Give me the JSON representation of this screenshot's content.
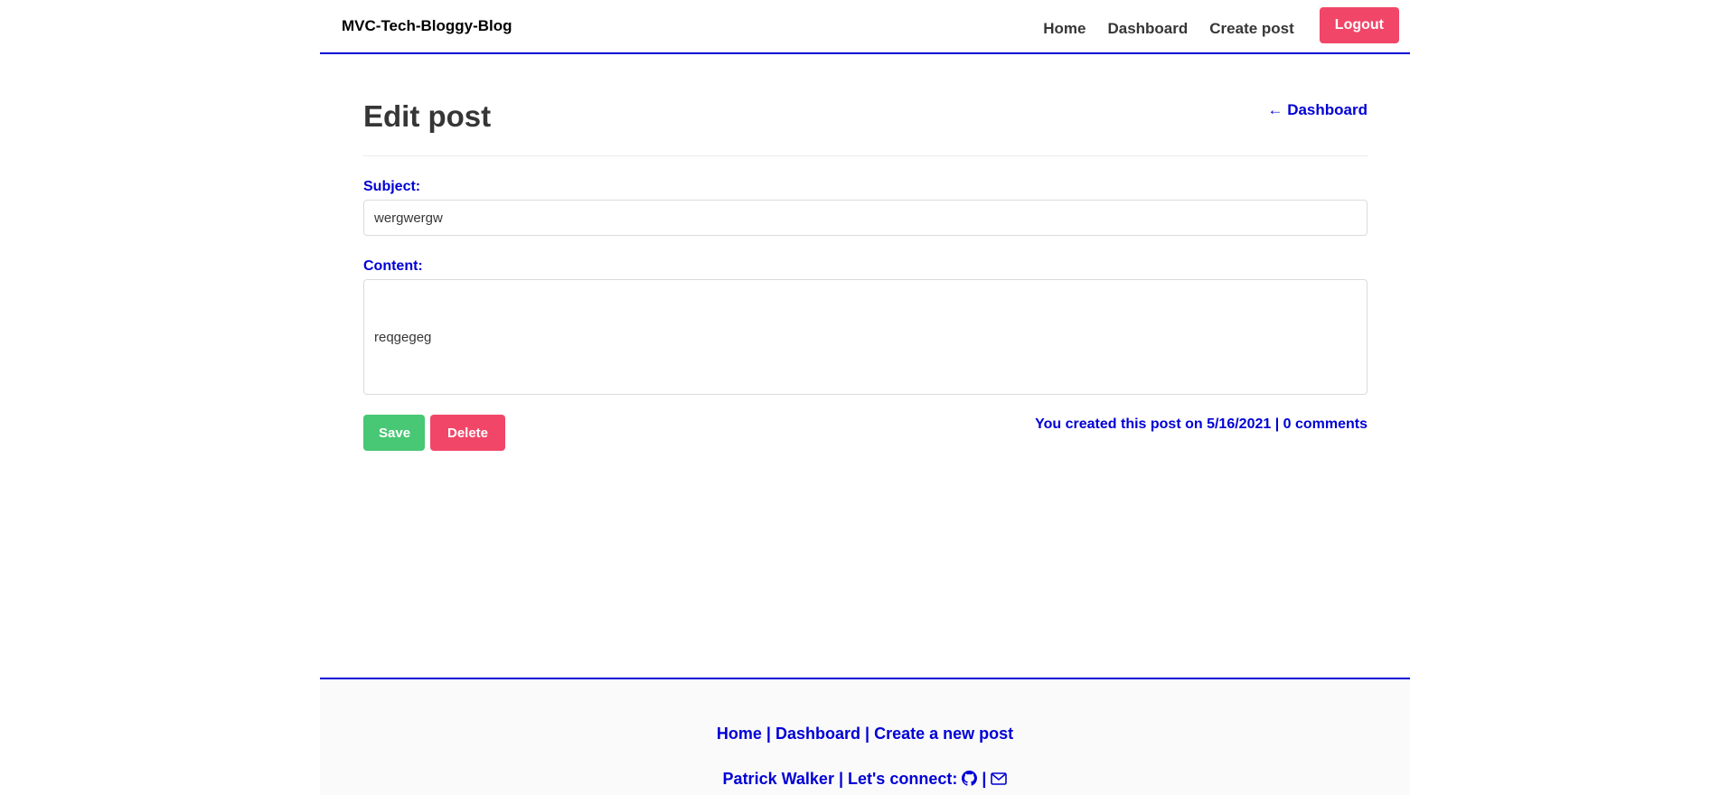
{
  "navbar": {
    "brand": "MVC-Tech-Bloggy-Blog",
    "links": [
      "Home",
      "Dashboard",
      "Create post"
    ],
    "logout_label": "Logout"
  },
  "main": {
    "title": "Edit post",
    "back_link": "← Dashboard",
    "subject_label": "Subject:",
    "subject_value": "wergwergw",
    "content_label": "Content:",
    "content_value": "reqgegeg",
    "save_label": "Save",
    "delete_label": "Delete",
    "post_meta": "You created this post on 5/16/2021 | 0 comments"
  },
  "footer": {
    "home": "Home",
    "dashboard": "Dashboard",
    "create": "Create a new post",
    "separator": "|",
    "author": "Patrick Walker",
    "connect": "Let's connect:",
    "icons": [
      "github-icon",
      "envelope-icon"
    ]
  },
  "colors": {
    "accent": "#0000d6",
    "danger": "#f14668",
    "success": "#48c774",
    "text": "#363636"
  }
}
